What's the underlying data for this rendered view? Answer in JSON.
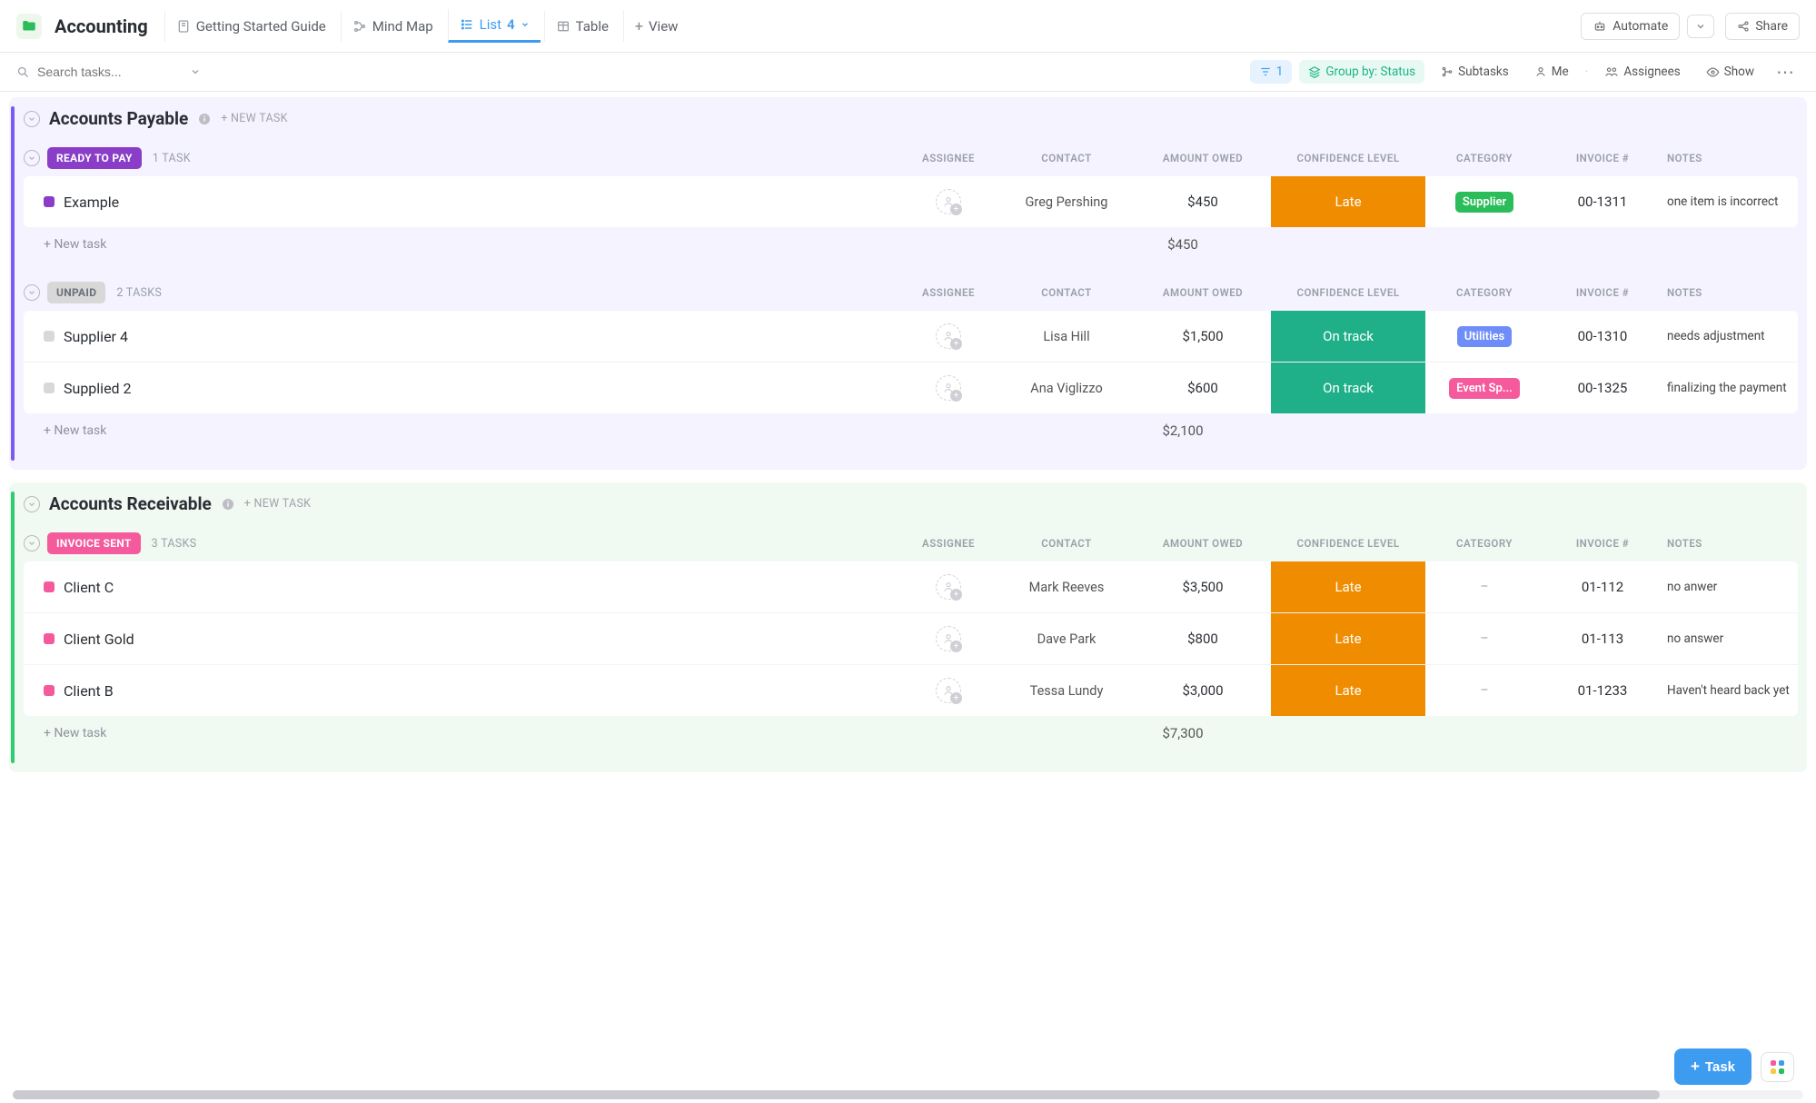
{
  "header": {
    "title": "Accounting",
    "views": [
      {
        "label": "Getting Started Guide",
        "active": false
      },
      {
        "label": "Mind Map",
        "active": false
      },
      {
        "label": "List",
        "badge": "4",
        "active": true
      },
      {
        "label": "Table",
        "active": false
      },
      {
        "label": "View",
        "add": true
      }
    ],
    "automate": "Automate",
    "share": "Share"
  },
  "filterbar": {
    "search_placeholder": "Search tasks...",
    "filter_count": "1",
    "group_label": "Group by: Status",
    "subtasks": "Subtasks",
    "me": "Me",
    "assignees": "Assignees",
    "show": "Show"
  },
  "columns": {
    "assignee": "ASSIGNEE",
    "contact": "CONTACT",
    "amount": "AMOUNT OWED",
    "confidence": "CONFIDENCE LEVEL",
    "category": "CATEGORY",
    "invoice": "INVOICE #",
    "notes": "NOTES"
  },
  "new_task_label": "+ NEW TASK",
  "new_task_row": "+ New task",
  "sections": [
    {
      "title": "Accounts Payable",
      "accent": "purple",
      "groups": [
        {
          "status_label": "READY TO PAY",
          "status_color": "#8a3ec8",
          "count_label": "1 TASK",
          "tasks": [
            {
              "name": "Example",
              "square_color": "#8a3ec8",
              "contact": "Greg Pershing",
              "amount": "$450",
              "confidence": "Late",
              "confidence_color": "#f08c00",
              "category": "Supplier",
              "category_color": "#2bbd5a",
              "invoice": "00-1311",
              "notes": "one item is incorrect"
            }
          ],
          "total": "$450"
        },
        {
          "status_label": "UNPAID",
          "status_color": "#d8d8d8",
          "status_text_color": "#6b6f78",
          "count_label": "2 TASKS",
          "tasks": [
            {
              "name": "Supplier 4",
              "square_color": "#d8d8d8",
              "contact": "Lisa Hill",
              "amount": "$1,500",
              "confidence": "On track",
              "confidence_color": "#1fb08a",
              "category": "Utilities",
              "category_color": "#6f8df9",
              "invoice": "00-1310",
              "notes": "needs adjustment"
            },
            {
              "name": "Supplied 2",
              "square_color": "#d8d8d8",
              "contact": "Ana Viglizzo",
              "amount": "$600",
              "confidence": "On track",
              "confidence_color": "#1fb08a",
              "category": "Event Sp...",
              "category_color": "#f55a9c",
              "invoice": "00-1325",
              "notes": "finalizing the payment"
            }
          ],
          "total": "$2,100"
        }
      ]
    },
    {
      "title": "Accounts Receivable",
      "accent": "green",
      "groups": [
        {
          "status_label": "INVOICE SENT",
          "status_color": "#f55a9c",
          "count_label": "3 TASKS",
          "tasks": [
            {
              "name": "Client C",
              "square_color": "#f55a9c",
              "contact": "Mark Reeves",
              "amount": "$3,500",
              "confidence": "Late",
              "confidence_color": "#f08c00",
              "category": "–",
              "category_plain": true,
              "invoice": "01-112",
              "notes": "no anwer"
            },
            {
              "name": "Client Gold",
              "square_color": "#f55a9c",
              "contact": "Dave Park",
              "amount": "$800",
              "confidence": "Late",
              "confidence_color": "#f08c00",
              "category": "–",
              "category_plain": true,
              "invoice": "01-113",
              "notes": "no answer"
            },
            {
              "name": "Client B",
              "square_color": "#f55a9c",
              "contact": "Tessa Lundy",
              "amount": "$3,000",
              "confidence": "Late",
              "confidence_color": "#f08c00",
              "category": "–",
              "category_plain": true,
              "invoice": "01-1233",
              "notes": "Haven't heard back yet"
            }
          ],
          "total": "$7,300"
        }
      ]
    }
  ],
  "fab": {
    "task": "Task"
  }
}
